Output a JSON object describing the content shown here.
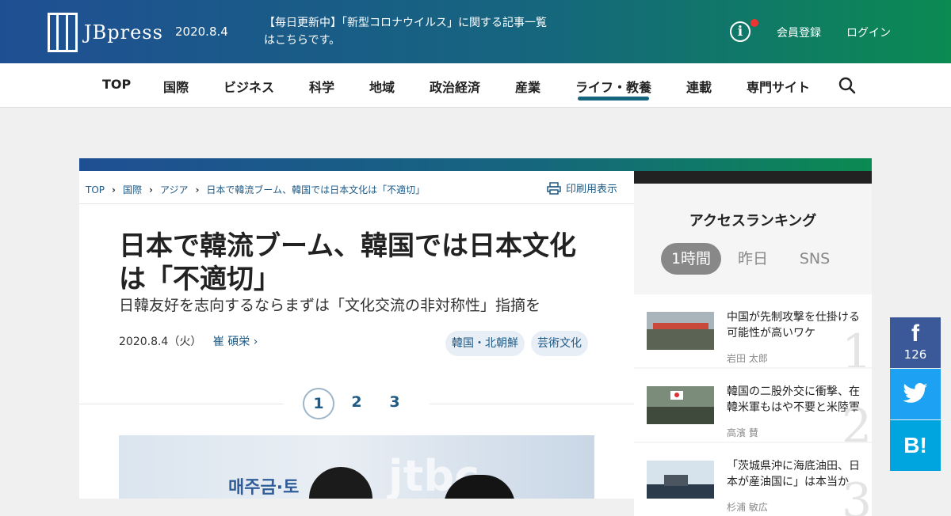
{
  "header": {
    "logo_text": "JBpress",
    "date": "2020.8.4",
    "notice": "【毎日更新中】「新型コロナウイルス」に関する記事一覧はこちらです。",
    "info_icon": "i",
    "signup": "会員登録",
    "login": "ログイン"
  },
  "nav": {
    "items": [
      "TOP",
      "国際",
      "ビジネス",
      "科学",
      "地域",
      "政治経済",
      "産業",
      "ライフ・教養",
      "連載",
      "専門サイト"
    ],
    "active": "ライフ・教養"
  },
  "breadcrumb": [
    "TOP",
    "国際",
    "アジア",
    "日本で韓流ブーム、韓国では日本文化は「不適切」"
  ],
  "print_label": "印刷用表示",
  "article": {
    "title": "日本で韓流ブーム、韓国では日本文化は「不適切」",
    "subtitle": "日韓友好を志向するならまずは「文化交流の非対称性」指摘を",
    "date": "2020.8.4（火）",
    "author": "崔 碩栄",
    "tags": [
      "韓国・北朝鮮",
      "芸術文化"
    ],
    "pages": [
      "1",
      "2",
      "3"
    ],
    "current_page": "1",
    "photo_sign_text": "매주금·토",
    "photo_logo_text": "jtbc"
  },
  "sidebar": {
    "title": "アクセスランキング",
    "tabs": [
      "1時間",
      "昨日",
      "SNS"
    ],
    "active_tab": "1時間",
    "items": [
      {
        "rank": "1",
        "title": "中国が先制攻撃を仕掛ける可能性が高いワケ",
        "author": "岩田 太郎"
      },
      {
        "rank": "2",
        "title": "韓国の二股外交に衝撃、在韓米軍もはや不要と米陸軍",
        "author": "高濱 賛"
      },
      {
        "rank": "3",
        "title": "「茨城県沖に海底油田、日本が産油国に」は本当か",
        "author": "杉浦 敏広"
      }
    ]
  },
  "social": {
    "facebook_icon": "f",
    "facebook_count": "126",
    "twitter_icon": "twitter-bird",
    "hatena_icon": "B!"
  },
  "colors": {
    "brand_blue": "#1f4f93",
    "brand_green": "#0b8a52",
    "link": "#1e5a86",
    "facebook": "#3b5998",
    "twitter": "#1da1f2",
    "hatena": "#00a4de"
  }
}
